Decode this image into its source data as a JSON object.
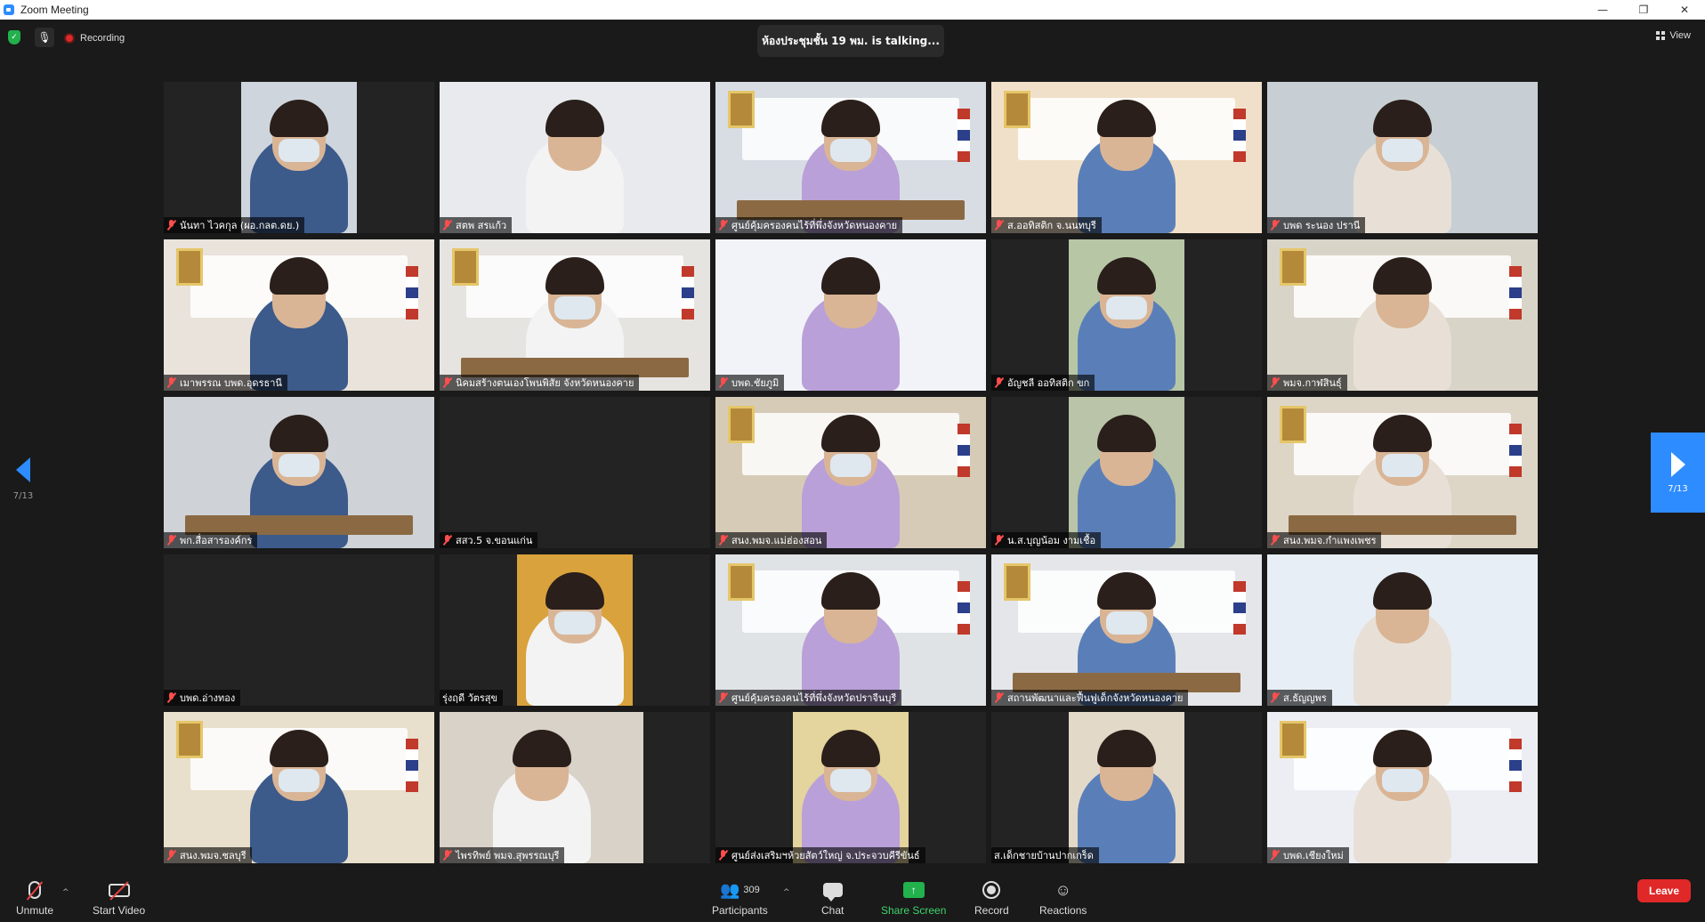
{
  "window": {
    "title": "Zoom Meeting"
  },
  "topbar": {
    "recording_label": "Recording",
    "speaker_text": "ห้องประชุมชั้น 19 พม. is  talking...",
    "view_label": "View"
  },
  "pagination": {
    "left": "7/13",
    "right": "7/13"
  },
  "tiles": [
    {
      "name": "นันทา ไวคกุล (ผอ.กลต.ดย.)",
      "muted": true,
      "style": "portrait",
      "bg": "#cfd5dc"
    },
    {
      "name": "สตพ สรแก้ว",
      "muted": true,
      "style": "full",
      "bg": "#e8eaee"
    },
    {
      "name": "ศูนย์คุ้มครองคนไร้ที่พึ่งจังหวัดหนองคาย",
      "muted": true,
      "style": "full",
      "bg": "#d8dde4"
    },
    {
      "name": "ส.ออทิสติก จ.นนทบุรี",
      "muted": true,
      "style": "full",
      "bg": "#f1e0c9"
    },
    {
      "name": "บพด ระนอง  ปรานี",
      "muted": true,
      "style": "full",
      "bg": "#c7cfd4"
    },
    {
      "name": "เมาพรรณ บพด.อุดรธานี",
      "muted": true,
      "style": "full",
      "bg": "#e9e3dc"
    },
    {
      "name": "นิคมสร้างตนเองโพนพิสัย จังหวัดหนองคาย",
      "muted": true,
      "style": "full",
      "bg": "#e6e4e0"
    },
    {
      "name": "บพด.ชัยภูมิ",
      "muted": true,
      "style": "full",
      "bg": "#f2f3f8"
    },
    {
      "name": "อัญชลี ออทิสติก ขก",
      "muted": true,
      "style": "portrait",
      "bg": "#b7c7a6"
    },
    {
      "name": "พมจ.กาฬสินธุ์",
      "muted": true,
      "style": "full",
      "bg": "#d9d4c8"
    },
    {
      "name": "พก.สื่อสารองค์กร",
      "muted": true,
      "style": "full",
      "bg": "#cfd3d8"
    },
    {
      "name": "สสว.5 จ.ขอนแก่น",
      "muted": true,
      "style": "empty",
      "bg": "#232323"
    },
    {
      "name": "สนง.พมจ.แม่ฮ่องสอน",
      "muted": true,
      "style": "full",
      "bg": "#d6cbb7"
    },
    {
      "name": "น.ส.บุญน้อม งามเชื้อ",
      "muted": true,
      "style": "portrait",
      "bg": "#b9c4a8"
    },
    {
      "name": "สนง.พมจ.กำแพงเพชร",
      "muted": true,
      "style": "full",
      "bg": "#ddd6c7"
    },
    {
      "name": "บพด.อ่างทอง",
      "muted": true,
      "style": "empty",
      "bg": "#232323"
    },
    {
      "name": "รุ่งฤดี วัตรสุข",
      "muted": false,
      "style": "portrait",
      "bg": "#d9a23c"
    },
    {
      "name": "ศูนย์คุ้มครองคนไร้ที่พึ่งจังหวัดปราจีนบุรี",
      "muted": true,
      "style": "full",
      "bg": "#dfe3e6"
    },
    {
      "name": "สถานพัฒนาและฟื้นฟูเด็กจังหวัดหนองคาย",
      "muted": true,
      "style": "full",
      "bg": "#e5e6ea"
    },
    {
      "name": "ส.ธัญญพร",
      "muted": true,
      "style": "full",
      "bg": "#e7eef5"
    },
    {
      "name": "สนง.พมจ.ชลบุรี",
      "muted": true,
      "style": "full",
      "bg": "#e8dfcc"
    },
    {
      "name": "ไพรทิพย์ พมจ.สุพรรณบุรี",
      "muted": true,
      "style": "semi",
      "bg": "#d8d2c8"
    },
    {
      "name": "ศูนย์ส่งเสริมฯห้วยสัตว์ใหญ่ จ.ประจวบคีรีขันธ์",
      "muted": true,
      "style": "portrait",
      "bg": "#e4d49d"
    },
    {
      "name": "ส.เด็กชายบ้านปากเกร็ด",
      "muted": false,
      "style": "portrait",
      "bg": "#e3d9c9"
    },
    {
      "name": "บพด.เชียงใหม่",
      "muted": true,
      "style": "full",
      "bg": "#eceef3"
    }
  ],
  "toolbar": {
    "unmute": "Unmute",
    "start_video": "Start Video",
    "participants": "Participants",
    "participants_count": "309",
    "chat": "Chat",
    "share_screen": "Share Screen",
    "record": "Record",
    "reactions": "Reactions",
    "leave": "Leave"
  },
  "colors": {
    "accent": "#2d8cff",
    "leave": "#e02828",
    "share": "#22b14c",
    "muted": "#ff4d4d"
  }
}
